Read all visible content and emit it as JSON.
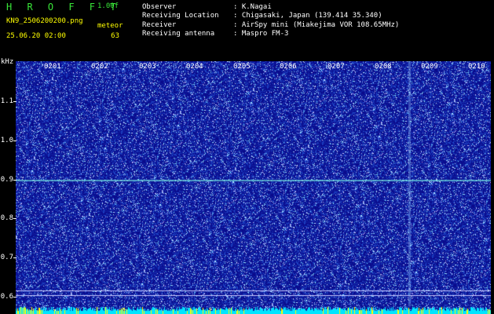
{
  "header": {
    "app_title": "H R O F F T",
    "version": "1.00f",
    "filename": "KN9_2506200200.png",
    "meteor_label": "meteor",
    "meteor_count": "63",
    "datetime": "25.06.20 02:00"
  },
  "info": {
    "observer_label": "Observer",
    "observer_value": ": K.Nagai",
    "location_label": "Receiving Location",
    "location_value": ": Chigasaki, Japan (139.414 35.340)",
    "receiver_label": "Receiver",
    "receiver_value": ": AirSpy mini (Miakejima VOR 108.65MHz)",
    "antenna_label": "Receiving antenna",
    "antenna_value": ": Maspro FM-3"
  },
  "axis": {
    "unit": "kHz",
    "y_ticks": [
      "1.1",
      "1.0",
      "0.9",
      "0.8",
      "0.7",
      "0.6"
    ],
    "time_labels": [
      "0201",
      "0202",
      "0203",
      "0204",
      "0205",
      "0206",
      "0207",
      "0208",
      "0209",
      "0210"
    ]
  },
  "colors": {
    "background": "#0a0a8c",
    "noise": "#6fa8ff",
    "trace": "#7fffe8",
    "label_green": "#39e639",
    "spike": "#ffff00"
  }
}
